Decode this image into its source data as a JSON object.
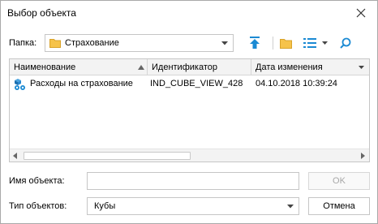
{
  "dialog": {
    "title": "Выбор объекта"
  },
  "folder": {
    "label": "Папка:",
    "value": "Страхование"
  },
  "toolbar": {
    "icons": [
      "arrow-up-icon",
      "folder-icon",
      "list-view-icon",
      "chevron-down-icon",
      "search-icon"
    ]
  },
  "grid": {
    "columns": [
      {
        "label": "Наименование",
        "sorted": "ascending"
      },
      {
        "label": "Идентификатор"
      },
      {
        "label": "Дата изменения"
      }
    ],
    "rows": [
      {
        "icon": "cube-icon",
        "name": "Расходы на страхование",
        "id": "IND_CUBE_VIEW_428",
        "date": "04.10.2018 10:39:24"
      }
    ]
  },
  "object_name": {
    "label": "Имя объекта:",
    "value": "",
    "ok_label": "OK"
  },
  "object_type": {
    "label": "Тип объектов:",
    "value": "Кубы",
    "cancel_label": "Отмена"
  },
  "colors": {
    "accent": "#1b8ad3",
    "folder": "#f6c34a",
    "border": "#c6c6c6",
    "header_bg": "#f3f3f3"
  }
}
